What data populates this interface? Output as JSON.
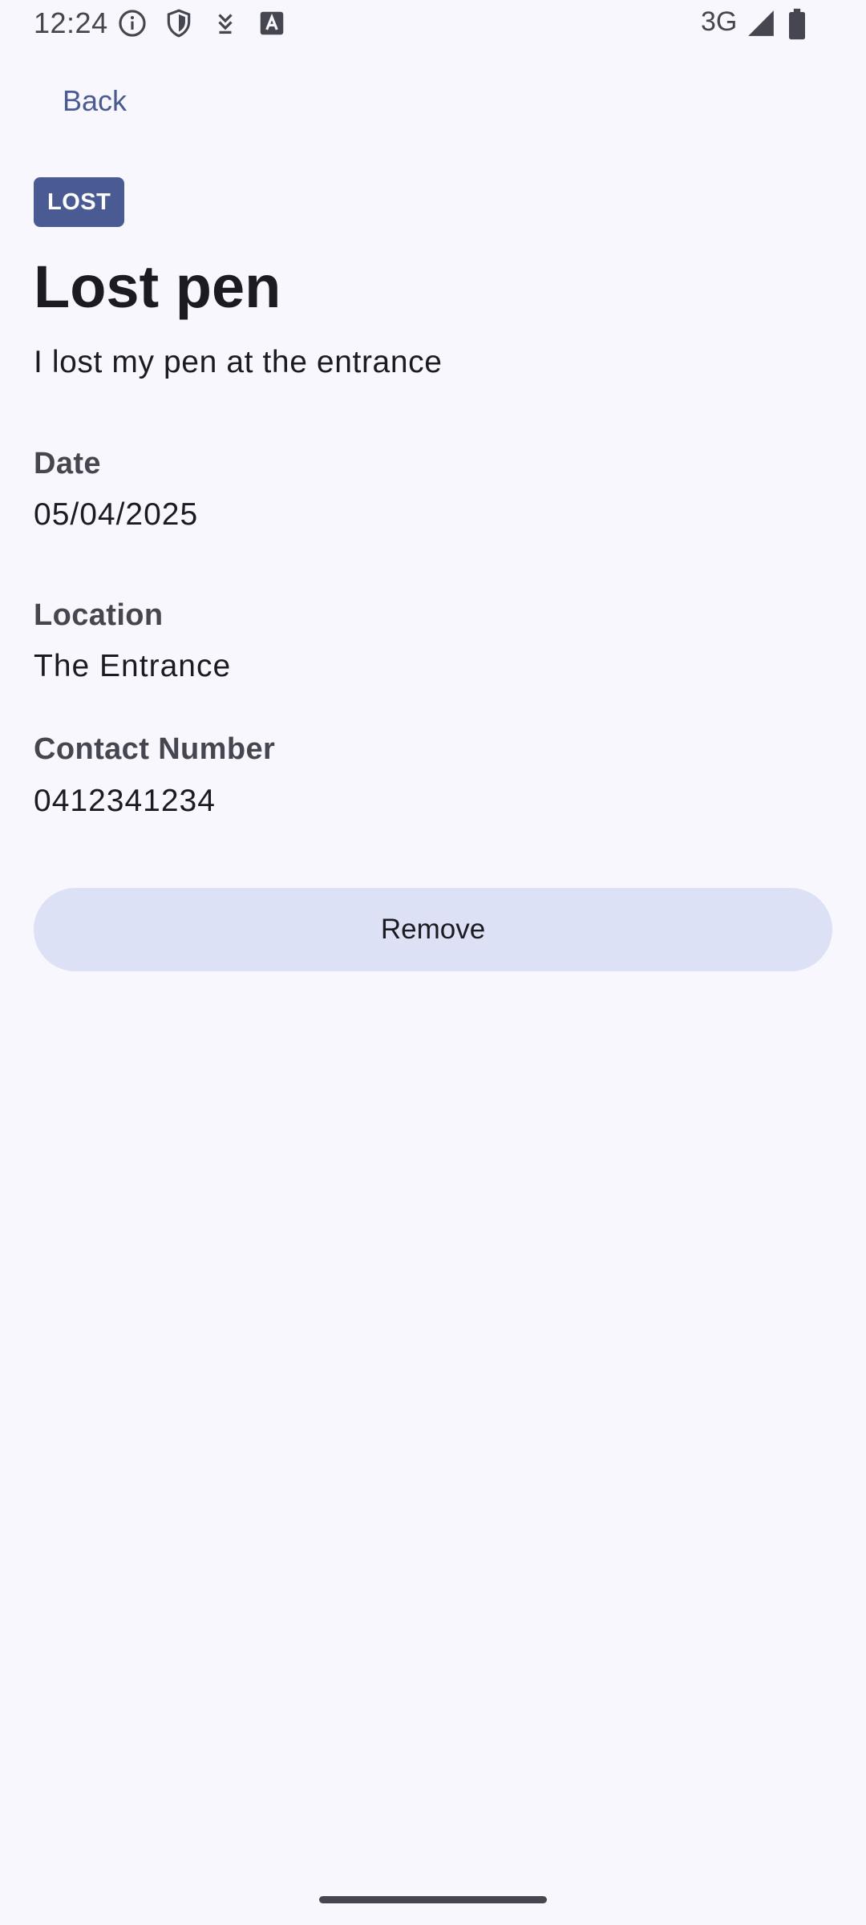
{
  "status_bar": {
    "time": "12:24",
    "network": "3G",
    "icons": [
      "info-icon",
      "shield-icon",
      "download-icon",
      "keyboard-a-icon",
      "signal-icon",
      "battery-icon"
    ]
  },
  "nav": {
    "back_label": "Back"
  },
  "item": {
    "badge": "LOST",
    "title": "Lost pen",
    "description": "I lost my pen at the entrance",
    "fields": [
      {
        "label": "Date",
        "value": "05/04/2025"
      },
      {
        "label": "Location",
        "value": "The Entrance"
      },
      {
        "label": "Contact Number",
        "value": "0412341234"
      }
    ]
  },
  "actions": {
    "remove_label": "Remove"
  },
  "colors": {
    "background": "#f8f7fd",
    "primary": "#4a5a92",
    "button_tonal": "#dde1f6",
    "on_surface": "#1b1b21",
    "on_surface_variant": "#45464f"
  }
}
